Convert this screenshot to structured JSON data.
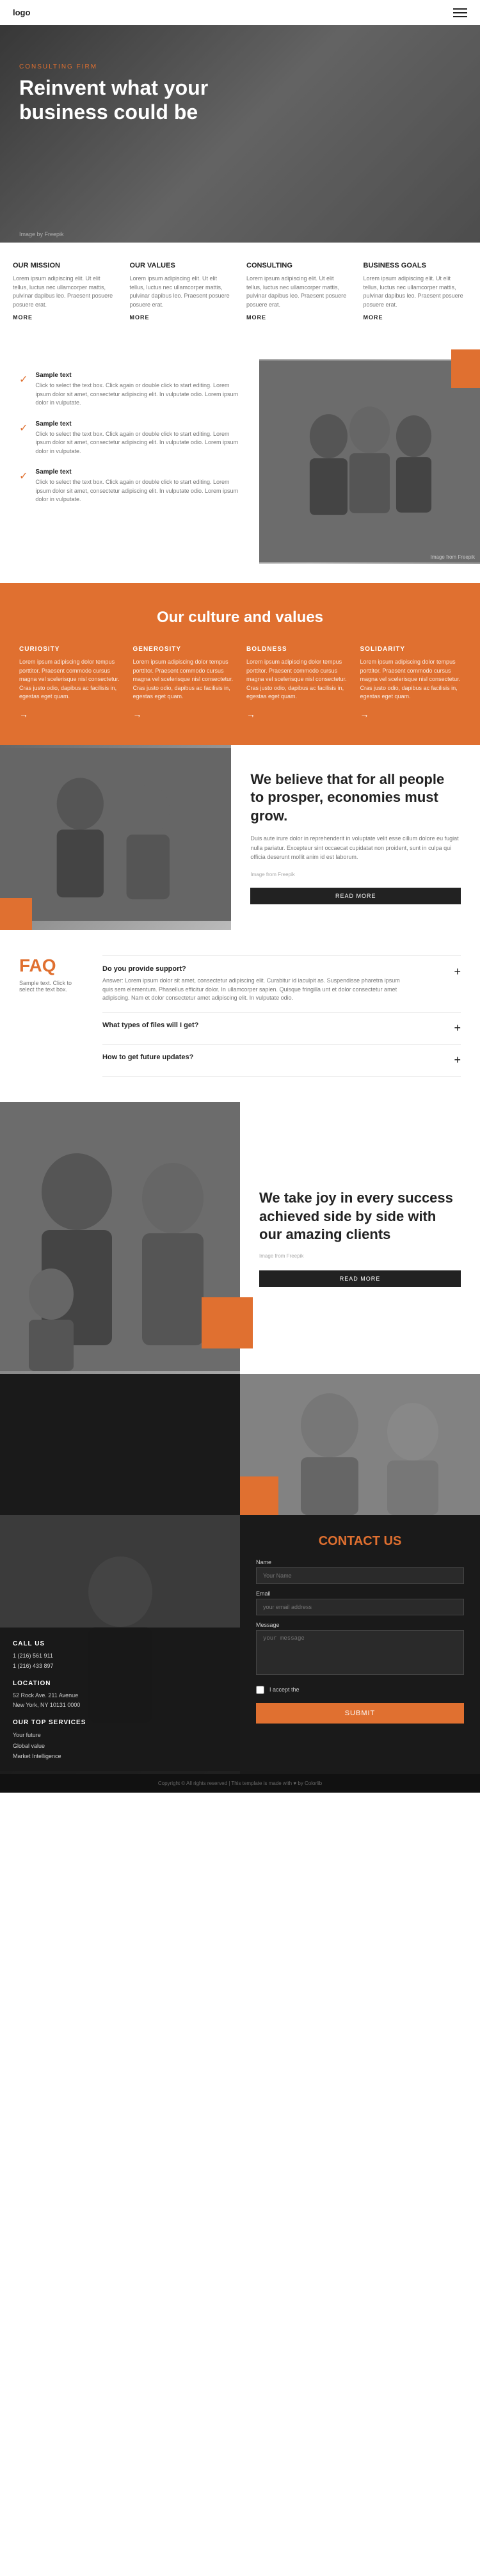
{
  "nav": {
    "logo": "logo",
    "menu_icon": "≡"
  },
  "hero": {
    "firm_label": "CONSULTING FIRM",
    "title": "Reinvent what your business could be",
    "image_credit": "Image by Freepik"
  },
  "mission": {
    "columns": [
      {
        "title": "Our Mission",
        "text": "Lorem ipsum adipiscing elit. Ut elit tellus, luctus nec ullamcorper mattis, pulvinar dapibus leo. Praesent posuere posuere erat.",
        "link": "MORE"
      },
      {
        "title": "Our Values",
        "text": "Lorem ipsum adipiscing elit. Ut elit tellus, luctus nec ullamcorper mattis, pulvinar dapibus leo. Praesent posuere posuere erat.",
        "link": "MORE"
      },
      {
        "title": "Consulting",
        "text": "Lorem ipsum adipiscing elit. Ut elit tellus, luctus nec ullamcorper mattis, pulvinar dapibus leo. Praesent posuere posuere erat.",
        "link": "MORE"
      },
      {
        "title": "Business Goals",
        "text": "Lorem ipsum adipiscing elit. Ut elit tellus, luctus nec ullamcorper mattis, pulvinar dapibus leo. Praesent posuere posuere erat.",
        "link": "MORE"
      }
    ]
  },
  "checklist": {
    "items": [
      {
        "title": "Sample text",
        "text": "Click to select the text box. Click again or double click to start editing. Lorem ipsum dolor sit amet, consectetur adipiscing elit. In vulputate odio. Lorem ipsum dolor in vulputate."
      },
      {
        "title": "Sample text",
        "text": "Click to select the text box. Click again or double click to start editing. Lorem ipsum dolor sit amet, consectetur adipiscing elit. In vulputate odio. Lorem ipsum dolor in vulputate."
      },
      {
        "title": "Sample text",
        "text": "Click to select the text box. Click again or double click to start editing. Lorem ipsum dolor sit amet, consectetur adipiscing elit. In vulputate odio. Lorem ipsum dolor in vulputate."
      }
    ],
    "image_credit": "Image from Freepik"
  },
  "culture": {
    "heading": "Our culture and values",
    "columns": [
      {
        "title": "CURIOSITY",
        "text": "Lorem ipsum adipiscing dolor tempus porttitor. Praesent commodo cursus magna vel scelerisque nisl consectetur. Cras justo odio, dapibus ac facilisis in, egestas eget quam."
      },
      {
        "title": "GENEROSITY",
        "text": "Lorem ipsum adipiscing dolor tempus porttitor. Praesent commodo cursus magna vel scelerisque nisl consectetur. Cras justo odio, dapibus ac facilisis in, egestas eget quam."
      },
      {
        "title": "BOLDNESS",
        "text": "Lorem ipsum adipiscing dolor tempus porttitor. Praesent commodo cursus magna vel scelerisque nisl consectetur. Cras justo odio, dapibus ac facilisis in, egestas eget quam."
      },
      {
        "title": "SOLIDARITY",
        "text": "Lorem ipsum adipiscing dolor tempus porttitor. Praesent commodo cursus magna vel scelerisque nisl consectetur. Cras justo odio, dapibus ac facilisis in, egestas eget quam."
      }
    ]
  },
  "believe": {
    "heading": "We believe that for all people to prosper, economies must grow.",
    "text": "Duis aute irure dolor in reprehenderit in voluptate velit esse cillum dolore eu fugiat nulla pariatur. Excepteur sint occaecat cupidatat non proident, sunt in culpa qui officia deserunt mollit anim id est laborum.",
    "image_credit": "Image from Freepik",
    "read_more": "READ MORE"
  },
  "faq": {
    "title": "FAQ",
    "subtitle": "Sample text. Click to select the text box.",
    "items": [
      {
        "question": "Do you provide support?",
        "answer": "Answer: Lorem ipsum dolor sit amet, consectetur adipiscing elit. Curabitur id iaculpit as. Suspendisse pharetra ipsum quis sem elementum. Phasellus efficitur dolor. In ullamcorper sapien. Quisque fringilla unt et dolor consectetur amet adipiscing. Nam et dolor consectetur amet adipiscing elit. In vulputate odio.",
        "open": true
      },
      {
        "question": "What types of files will I get?",
        "answer": "",
        "open": false
      },
      {
        "question": "How to get future updates?",
        "answer": "",
        "open": false
      }
    ]
  },
  "clients": {
    "heading": "We take joy in every success achieved side by side with our amazing clients",
    "image_by": "Image from Freepik",
    "read_more": "READ MORE"
  },
  "contact": {
    "heading": "CONTACT US",
    "call_title": "CALL US",
    "call_lines": [
      "1 (216) 561 911",
      "1 (216) 433 897"
    ],
    "location_title": "LOCATION",
    "location_lines": [
      "52 Rock Ave. 211 Avenue",
      "New York, NY 10131 0000"
    ],
    "top_services_title": "OUR TOP SERVICES",
    "services": [
      "Your future",
      "Global value",
      "Market Intelligence"
    ],
    "form": {
      "name_label": "Name",
      "name_placeholder": "Your Name",
      "email_label": "Email",
      "email_placeholder": "your email address",
      "message_label": "Message",
      "message_placeholder": "your message",
      "checkbox_label": "I accept the",
      "submit_label": "SUBMIT"
    }
  },
  "footer": {
    "text": "Copyright © All rights reserved | This template is made with ♥ by Colorlib"
  }
}
